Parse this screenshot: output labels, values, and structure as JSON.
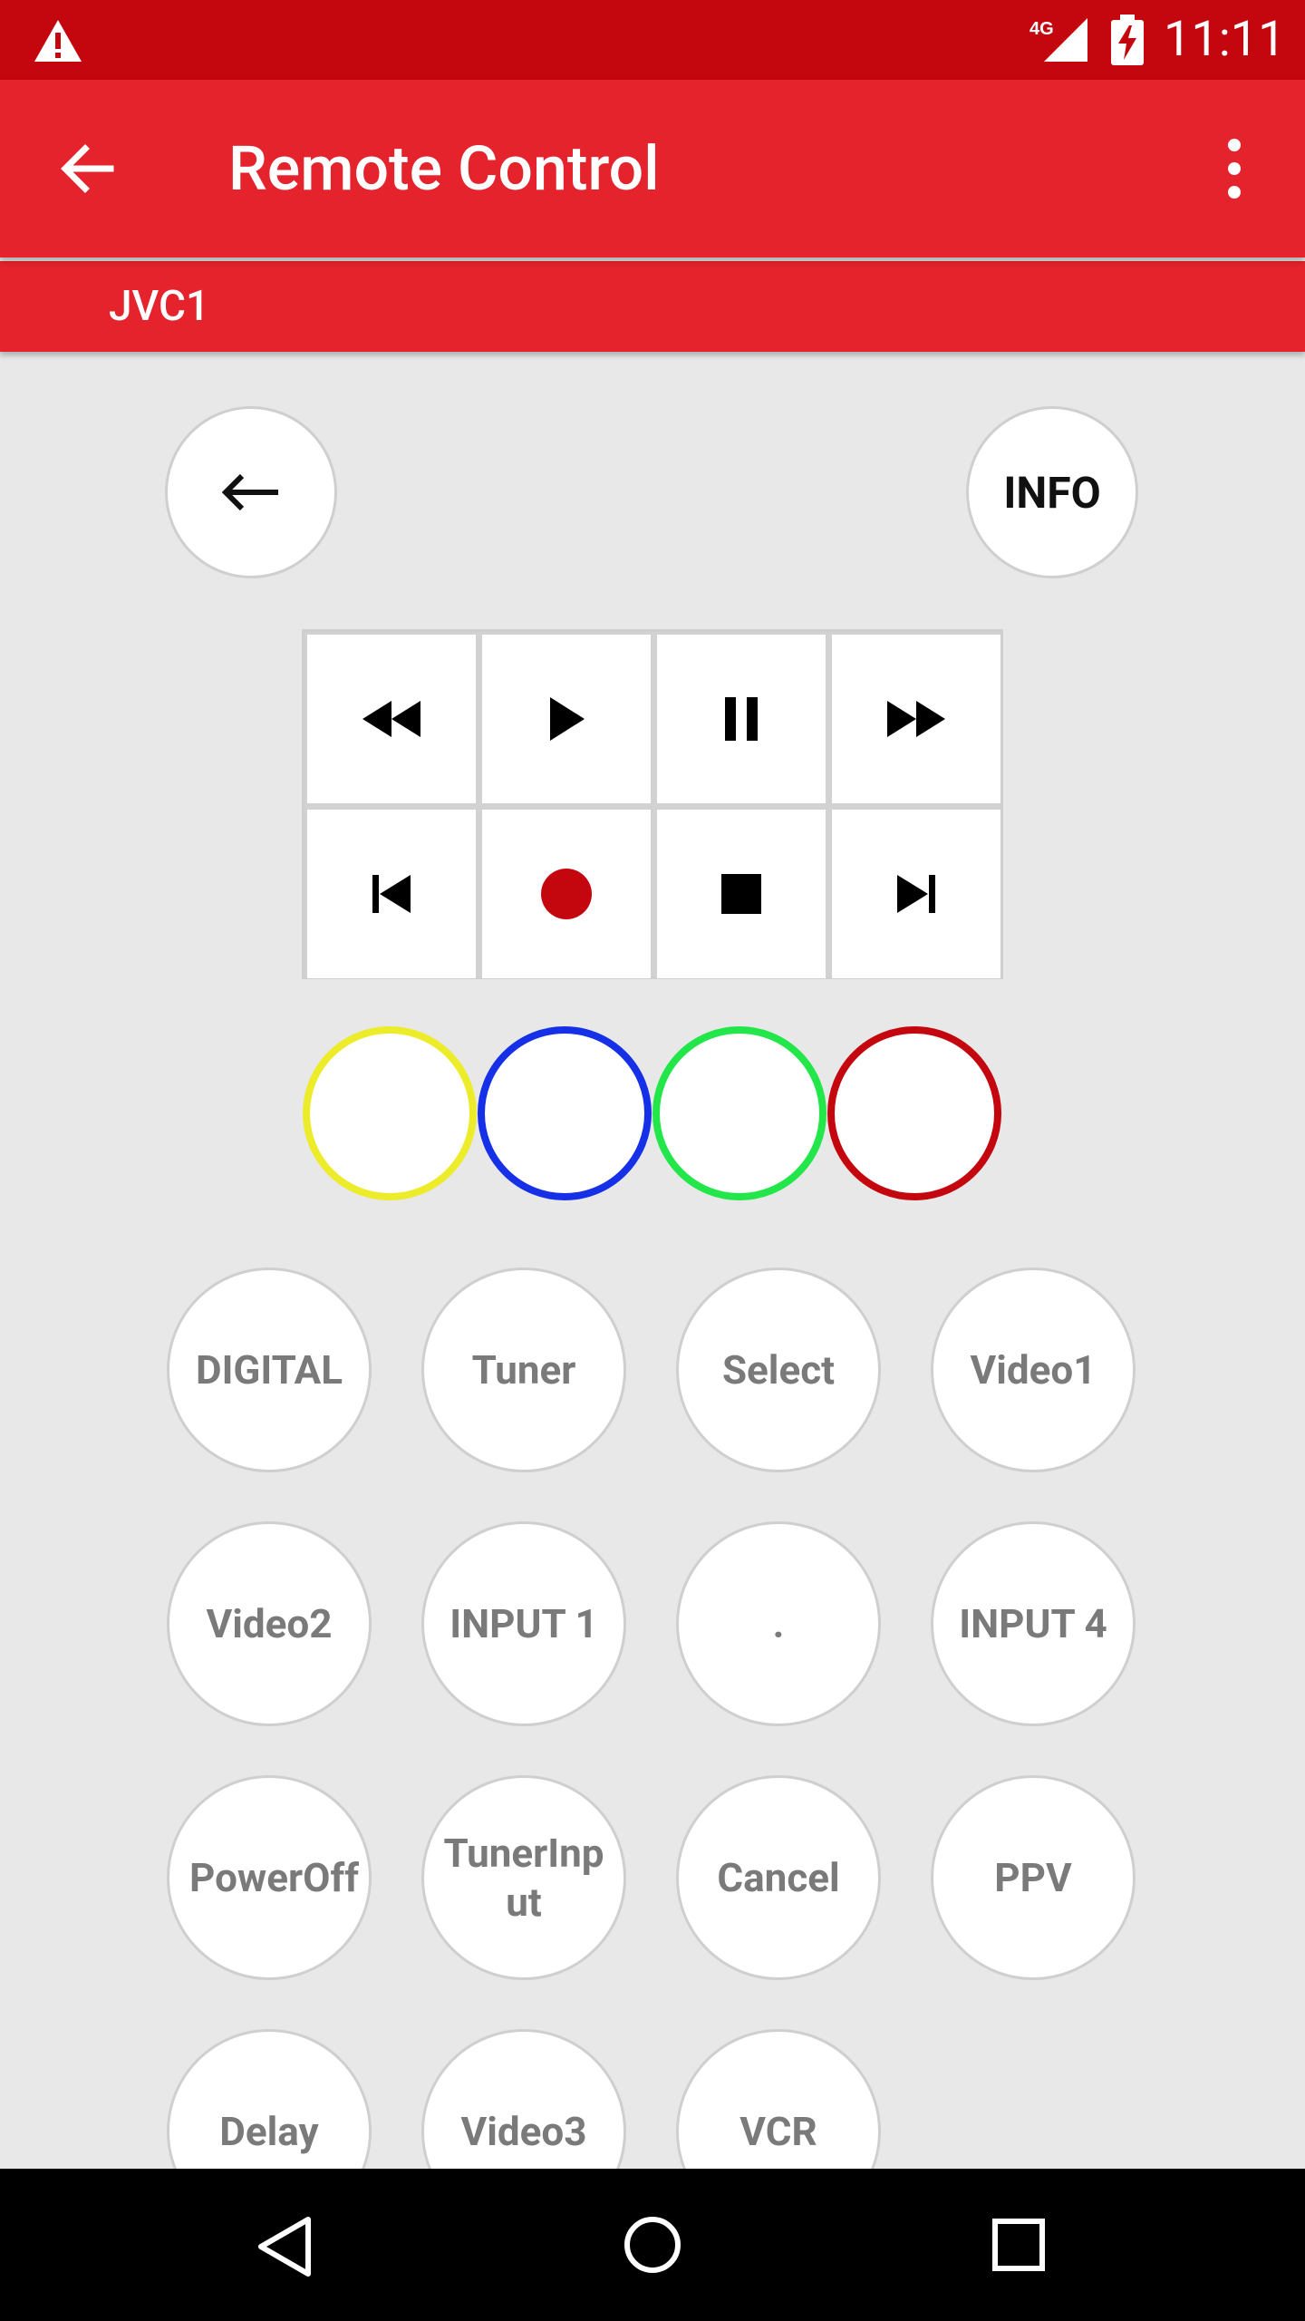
{
  "status_bar": {
    "time": "11:11",
    "network": "4G",
    "icons": [
      "warning-icon",
      "cell-signal-icon",
      "battery-charging-icon"
    ]
  },
  "app_bar": {
    "title": "Remote Control",
    "icons": [
      "back-arrow-icon",
      "more-vert-icon"
    ]
  },
  "tab": {
    "label": "JVC1"
  },
  "top_controls": {
    "back_icon": "back-arrow-icon",
    "info_label": "INFO"
  },
  "transport": {
    "icons": [
      "rewind-icon",
      "play-icon",
      "pause-icon",
      "fast-forward-icon",
      "skip-previous-icon",
      "record-icon",
      "stop-icon",
      "skip-next-icon"
    ],
    "record_color": "#c4070f"
  },
  "color_buttons": [
    {
      "name": "yellow",
      "color": "#ecec2a"
    },
    {
      "name": "blue",
      "color": "#1530e6"
    },
    {
      "name": "green",
      "color": "#22e64a"
    },
    {
      "name": "red",
      "color": "#c4070f"
    }
  ],
  "buttons": [
    "DIGITAL",
    "Tuner",
    "Select",
    "Video1",
    "Video2",
    "INPUT 1",
    ".",
    "INPUT 4",
    "PowerOff",
    "TunerInp ut",
    "Cancel",
    "PPV",
    "Delay",
    "Video3",
    "VCR"
  ],
  "nav_bar": {
    "icons": [
      "nav-back-icon",
      "nav-home-icon",
      "nav-recents-icon"
    ]
  },
  "colors": {
    "status_bar": "#c4070f",
    "app_bar": "#e5232c",
    "background": "#e8e8e8"
  }
}
